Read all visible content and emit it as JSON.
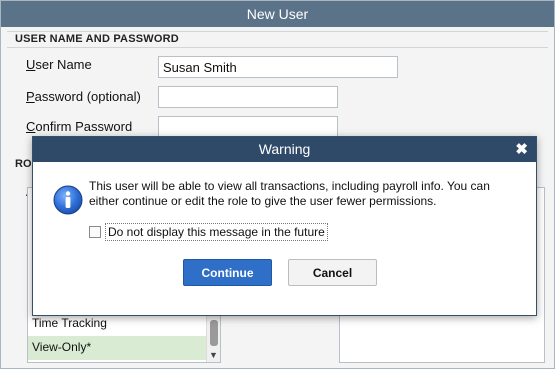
{
  "window": {
    "title": "New User",
    "section_user_password": "USER NAME AND PASSWORD",
    "fields": {
      "username_label_ul": "U",
      "username_label_rest": "ser Name",
      "username_value": "Susan Smith",
      "password_label_ul": "P",
      "password_label_rest": "assword (optional)",
      "confirm_label_ul": "C",
      "confirm_label_rest": "onfirm Password"
    },
    "roles_section_partial": "RO",
    "roles_list_partial_letter": "A",
    "roles": {
      "items_visible": [
        "Time Tracking",
        "View-Only*"
      ],
      "selected_index": 1
    }
  },
  "dialog": {
    "title": "Warning",
    "close_glyph": "✖",
    "message": "This user will be able to view all transactions, including payroll info. You can either continue or edit the role to give the user fewer permissions.",
    "checkbox_label": "Do not display this message in the future",
    "checkbox_checked": false,
    "continue_label": "Continue",
    "cancel_label": "Cancel",
    "icon": "info-icon",
    "colors": {
      "accent": "#2f6fc7",
      "titlebar": "#2f4a68"
    }
  }
}
